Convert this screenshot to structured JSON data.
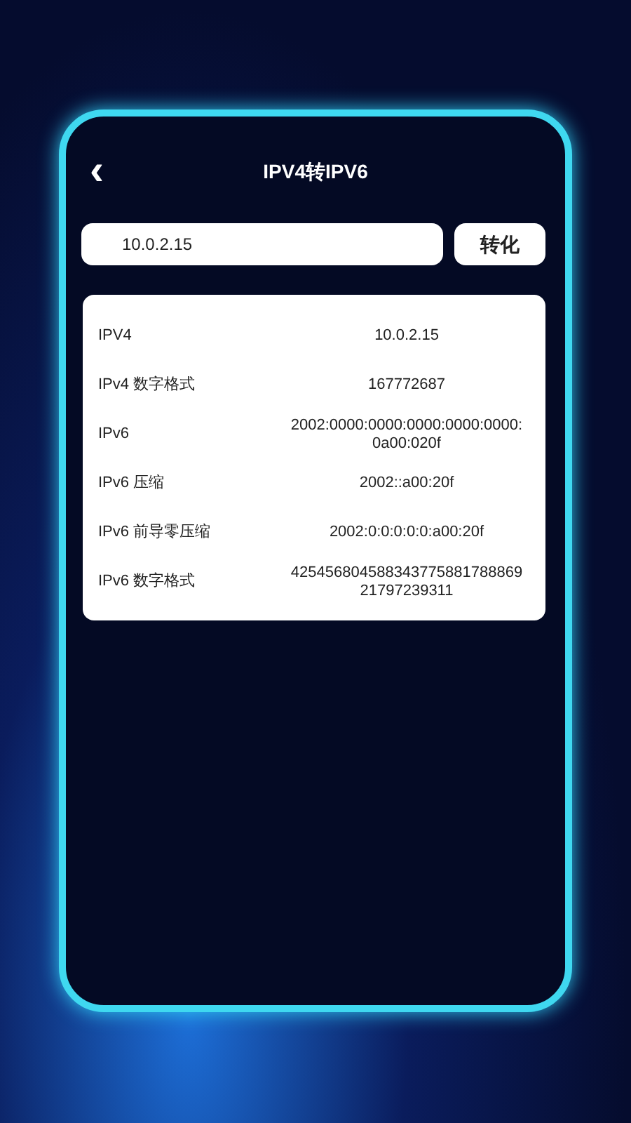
{
  "header": {
    "back": "‹",
    "title": "IPV4转IPV6"
  },
  "input": {
    "value": "10.0.2.15"
  },
  "convert_button": "转化",
  "results": [
    {
      "label": "IPV4",
      "value": "10.0.2.15"
    },
    {
      "label": "IPv4 数字格式",
      "value": "167772687"
    },
    {
      "label": "IPv6",
      "value": "2002:0000:0000:0000:0000:0000:0a00:020f"
    },
    {
      "label": "IPv6 压缩",
      "value": "2002::a00:20f"
    },
    {
      "label": "IPv6 前导零压缩",
      "value": "2002:0:0:0:0:0:a00:20f"
    },
    {
      "label": "IPv6 数字格式",
      "value": "42545680458834377588178886921797239311"
    }
  ]
}
